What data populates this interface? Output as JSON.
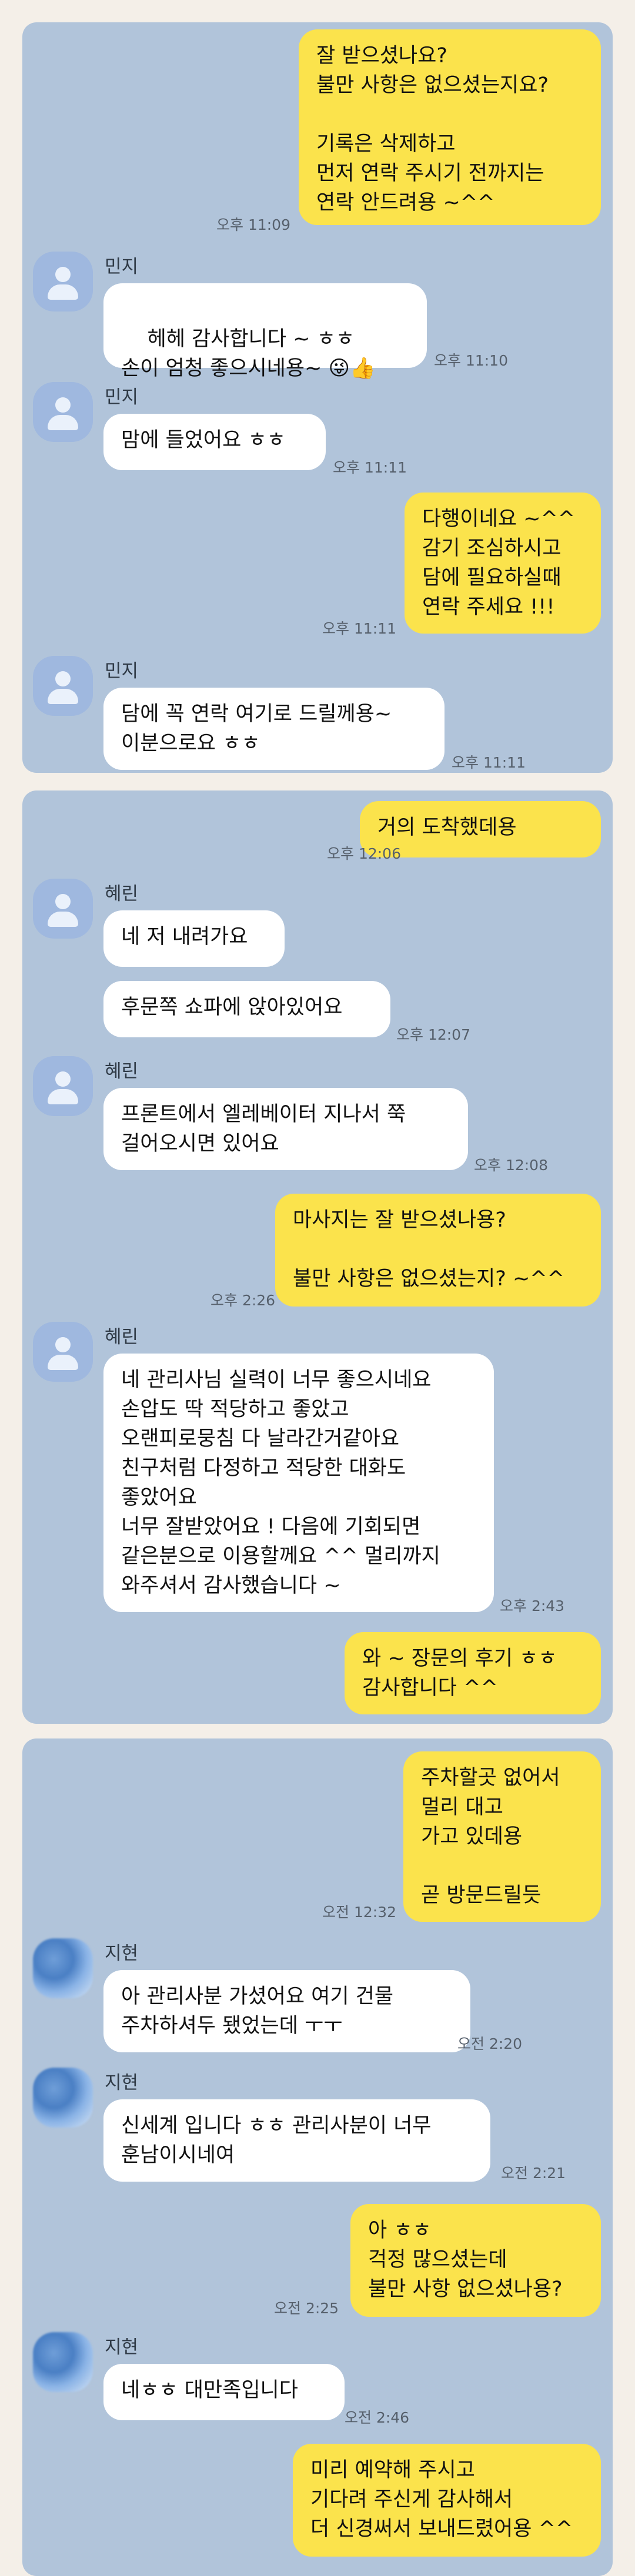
{
  "panels": [
    {
      "messages": [
        {
          "dir": "out",
          "text": "잘 받으셨나요?\n불만 사항은 없으셨는지요?\n\n기록은 삭제하고\n먼저 연락 주시기 전까지는\n연락 안드려용 ~^^",
          "time": "오후 11:09"
        },
        {
          "dir": "in",
          "name": "민지",
          "text": "헤헤 감사합니다 ~ ㅎㅎ\n손이 엄청 좋으시네용~ 😜👍",
          "time": "오후 11:10"
        },
        {
          "dir": "in",
          "name": "민지",
          "text": "맘에 들었어요 ㅎㅎ",
          "time": "오후 11:11"
        },
        {
          "dir": "out",
          "text": "다행이네요 ~^^\n감기 조심하시고\n담에 필요하실때\n연락 주세요 !!!",
          "time": "오후 11:11"
        },
        {
          "dir": "in",
          "name": "민지",
          "text": "담에 꼭 연락 여기로 드릴께용~\n이분으로요 ㅎㅎ",
          "time": "오후 11:11"
        }
      ]
    },
    {
      "messages": [
        {
          "dir": "out",
          "text": "거의 도착했데용",
          "time": "오후 12:06"
        },
        {
          "dir": "in",
          "name": "혜린",
          "text": "네 저 내려가요",
          "time": ""
        },
        {
          "dir": "in",
          "name": "",
          "text": "후문쪽 쇼파에 앉아있어요",
          "time": "오후 12:07"
        },
        {
          "dir": "in",
          "name": "혜린",
          "text": "프론트에서 엘레베이터 지나서 쭉\n걸어오시면 있어요",
          "time": "오후 12:08"
        },
        {
          "dir": "out",
          "text": "마사지는 잘 받으셨나용?\n\n불만 사항은 없으셨는지? ~^^",
          "time": "오후 2:26"
        },
        {
          "dir": "in",
          "name": "혜린",
          "text": "네 관리사님 실력이 너무 좋으시네요\n손압도 딱 적당하고 좋았고\n오랜피로뭉침 다 날라간거같아요\n친구처럼 다정하고 적당한 대화도\n좋았어요\n너무 잘받았어요 ! 다음에 기회되면\n같은분으로 이용할께요 ^^ 멀리까지\n와주셔서 감사했습니다 ~",
          "time": "오후 2:43"
        },
        {
          "dir": "out",
          "text": "와 ~ 장문의 후기 ㅎㅎ\n감사합니다 ^^",
          "time": ""
        }
      ]
    },
    {
      "messages": [
        {
          "dir": "out",
          "text": "주차할곳 없어서\n멀리 대고\n가고 있데용\n\n곧 방문드릴듯",
          "time": "오전 12:32"
        },
        {
          "dir": "in",
          "name": "지현",
          "text": "아 관리사분 가셨어요 여기 건물\n주차하셔두 됐었는데 ㅜㅜ",
          "time": "오전 2:20"
        },
        {
          "dir": "in",
          "name": "지현",
          "text": "신세계 입니다 ㅎㅎ 관리사분이 너무\n훈남이시네여",
          "time": "오전 2:21"
        },
        {
          "dir": "out",
          "text": "아 ㅎㅎ\n걱정 많으셨는데\n불만 사항 없으셨나용?",
          "time": "오전 2:25"
        },
        {
          "dir": "in",
          "name": "지현",
          "text": "네ㅎㅎ 대만족입니다",
          "time": "오전 2:46"
        },
        {
          "dir": "out",
          "text": "미리 예약해 주시고\n기다려 주신게 감사해서\n더 신경써서 보내드렸어용 ^^",
          "time": ""
        }
      ]
    }
  ],
  "colors": {
    "panel": "#b1c4da",
    "outgoing": "#fbe34c",
    "incoming": "#ffffff",
    "background": "#f4efe8"
  }
}
